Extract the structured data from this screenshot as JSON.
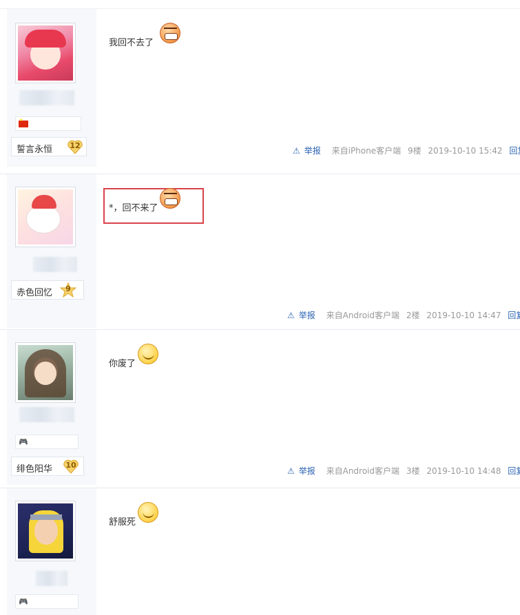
{
  "posts": [
    {
      "message": "我回不去了",
      "emoji": "angry-face-icon",
      "level_name": "誓言永恒",
      "level_num": "12",
      "badge": "china-flag-icon",
      "meta": {
        "report": "举报",
        "source": "来自iPhone客户端",
        "floor": "9楼",
        "time": "2019-10-10 15:42",
        "reply": "回复"
      }
    },
    {
      "message": "*，回不来了",
      "emoji": "angry-face-icon",
      "level_name": "赤色回忆",
      "level_num": "9",
      "badge": "",
      "meta": {
        "report": "举报",
        "source": "来自Android客户端",
        "floor": "2楼",
        "time": "2019-10-10 14:47",
        "reply": "回复"
      }
    },
    {
      "message": "你废了",
      "emoji": "smile-face-icon",
      "level_name": "绯色阳华",
      "level_num": "10",
      "badge": "game-icon",
      "meta": {
        "report": "举报",
        "source": "来自Android客户端",
        "floor": "3楼",
        "time": "2019-10-10 14:48",
        "reply": "回复"
      }
    },
    {
      "message": "舒服死",
      "emoji": "smile-face-icon",
      "badge": "game-icon"
    }
  ],
  "colors": {
    "highlight": "#d9424a",
    "link": "#2d64b3",
    "meta": "#999999"
  }
}
